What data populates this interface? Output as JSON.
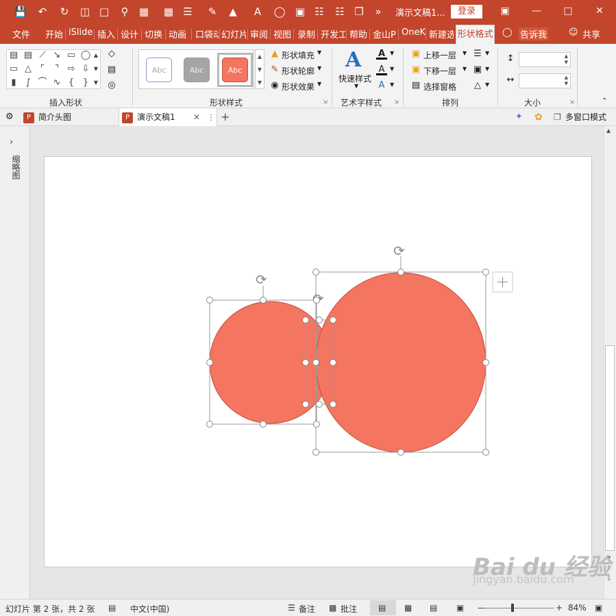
{
  "quick_access": {
    "save_icon": "save-icon",
    "undo_icon": "undo-icon",
    "redo_icon": "redo-icon",
    "more_icon": "more-icon"
  },
  "title_bar": {
    "doc_title": "演示文稿1...",
    "login": "登录"
  },
  "tabs": [
    "文件",
    "开始",
    "iSlide",
    "插入",
    "设计",
    "切换",
    "动画",
    "口袋动",
    "幻灯片",
    "审阅",
    "视图",
    "录制",
    "开发工",
    "帮助",
    "金山P",
    "OneK",
    "新建选"
  ],
  "active_tab": "形状格式",
  "tell_me": "告诉我",
  "share": "共享",
  "ribbon": {
    "insert_shapes_label": "插入形状",
    "shape_styles_label": "形状样式",
    "style_samples": [
      "Abc",
      "Abc",
      "Abc"
    ],
    "shape_fill": "形状填充",
    "shape_outline": "形状轮廓",
    "shape_effects": "形状效果",
    "quick_styles": "快速样式",
    "art_text_label": "艺术字样式",
    "bring_forward": "上移一层",
    "send_backward": "下移一层",
    "selection_pane": "选择窗格",
    "arrange_label": "排列",
    "size_label": "大小",
    "height_value": "",
    "width_value": ""
  },
  "doc_tabs": {
    "tab1": "简介头图",
    "tab2": "演示文稿1",
    "multi_window": "多窗口模式"
  },
  "left_pane": {
    "label": "缩略图"
  },
  "slide": {
    "shape_color": "#f47560",
    "shape_outline": "#c0503c"
  },
  "status": {
    "slide_info": "幻灯片 第 2 张，共 2 张",
    "language": "中文(中国)",
    "notes": "备注",
    "comments": "批注",
    "zoom": "84%"
  },
  "watermark": {
    "brand": "Bai du 经验",
    "url": "jingyan.baidu.com"
  },
  "colors": {
    "accent": "#c3452b",
    "ribbon_bg": "#f3f3f3"
  }
}
